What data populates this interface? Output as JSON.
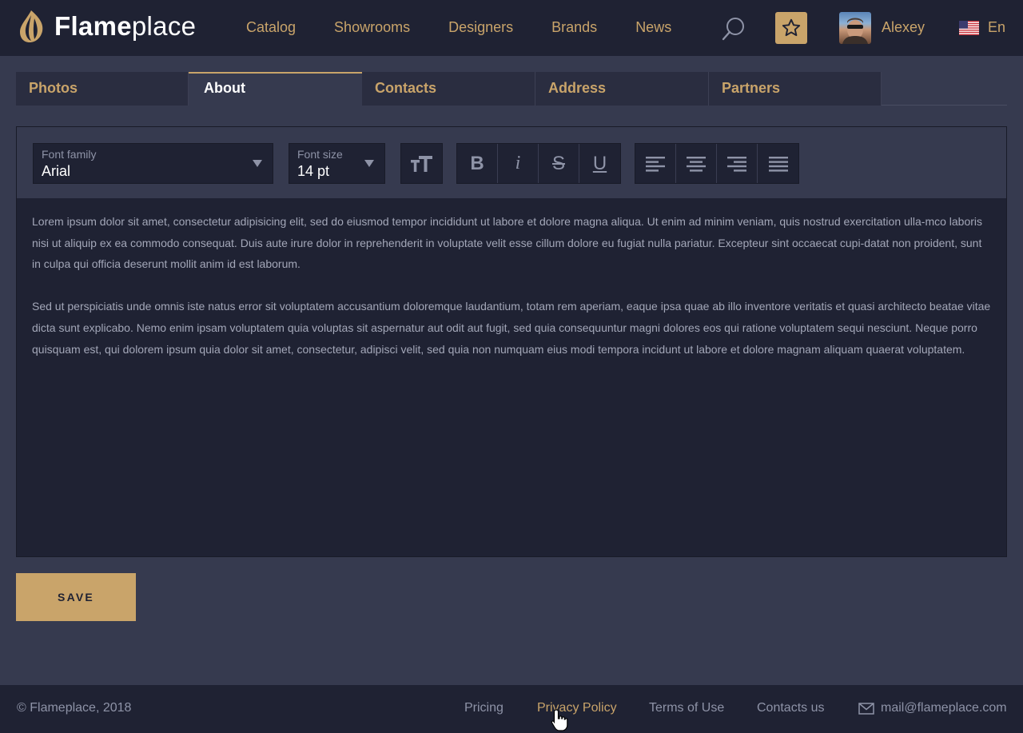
{
  "header": {
    "logo_bold": "Flame",
    "logo_light": "place",
    "nav": [
      "Catalog",
      "Showrooms",
      "Designers",
      "Brands",
      "News"
    ],
    "user_name": "Alexey",
    "language": "En"
  },
  "tabs": [
    {
      "label": "Photos",
      "active": false
    },
    {
      "label": "About",
      "active": true
    },
    {
      "label": "Contacts",
      "active": false
    },
    {
      "label": "Address",
      "active": false
    },
    {
      "label": "Partners",
      "active": false
    }
  ],
  "toolbar": {
    "font_family_label": "Font family",
    "font_family_value": "Arial",
    "font_size_label": "Font size",
    "font_size_value": "14 pt",
    "bold_glyph": "B",
    "italic_glyph": "i",
    "strike_glyph": "S",
    "underline_glyph": "U"
  },
  "content": {
    "paragraphs": [
      "Lorem ipsum dolor sit amet, consectetur adipisicing elit, sed do eiusmod tempor incididunt ut labore et dolore magna aliqua. Ut enim ad minim veniam, quis nostrud exercitation ulla-mco laboris nisi ut aliquip ex ea commodo consequat. Duis aute irure dolor in reprehenderit in voluptate velit esse cillum dolore eu fugiat nulla pariatur. Excepteur sint occaecat cupi-datat non proident, sunt in culpa qui officia deserunt mollit anim id est laborum.",
      "Sed ut perspiciatis unde omnis iste natus error sit voluptatem accusantium doloremque laudantium, totam rem aperiam, eaque ipsa quae ab illo inventore veritatis et quasi architecto beatae vitae dicta sunt explicabo. Nemo enim ipsam voluptatem quia voluptas sit aspernatur aut odit aut fugit, sed quia consequuntur magni dolores eos qui ratione voluptatem sequi nesciunt. Neque porro quisquam est, qui dolorem ipsum quia dolor sit amet, consectetur, adipisci velit, sed quia non numquam eius modi tempora incidunt ut labore et dolore magnam aliquam quaerat voluptatem."
    ]
  },
  "save_label": "SAVE",
  "footer": {
    "copyright": "© Flameplace, 2018",
    "links": [
      "Pricing",
      "Privacy Policy",
      "Terms of Use",
      "Contacts us"
    ],
    "active_link": "Privacy Policy",
    "email": "mail@flameplace.com"
  },
  "colors": {
    "accent": "#c9a46a",
    "header_bg": "#1f2233",
    "page_bg": "#363a4f"
  },
  "icons": [
    "flame-logo-icon",
    "search-icon",
    "star-icon",
    "us-flag-icon",
    "text-size-icon",
    "align-left-icon",
    "align-center-icon",
    "align-right-icon",
    "align-justify-icon",
    "mail-icon",
    "hand-cursor-icon"
  ]
}
